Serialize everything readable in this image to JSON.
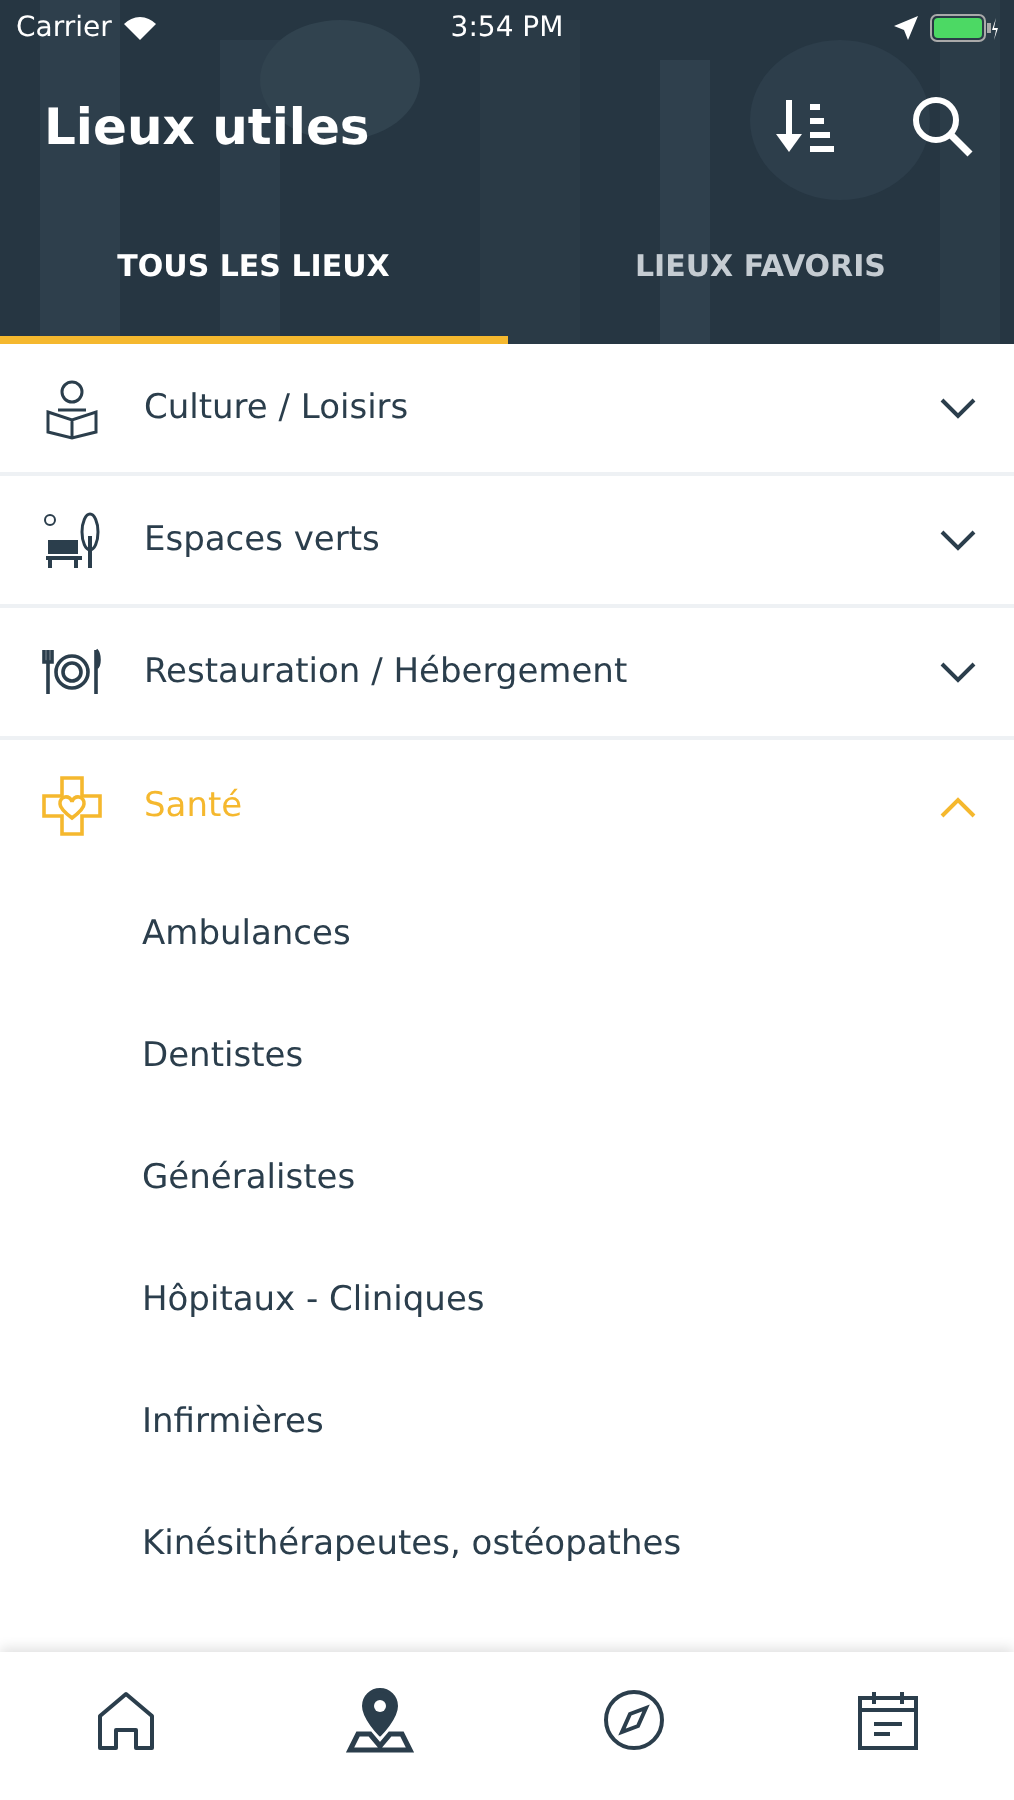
{
  "status_bar": {
    "carrier": "Carrier",
    "time": "3:54 PM"
  },
  "header": {
    "title": "Lieux utiles"
  },
  "tabs": [
    {
      "label": "TOUS LES LIEUX",
      "selected": true
    },
    {
      "label": "LIEUX FAVORIS",
      "selected": false
    }
  ],
  "categories": [
    {
      "kind": "culture",
      "label": "Culture / Loisirs",
      "expanded": false
    },
    {
      "kind": "park",
      "label": "Espaces verts",
      "expanded": false
    },
    {
      "kind": "food",
      "label": "Restauration / Hébergement",
      "expanded": false
    },
    {
      "kind": "health",
      "label": "Santé",
      "expanded": true,
      "children": [
        "Ambulances",
        "Dentistes",
        "Généralistes",
        "Hôpitaux - Cliniques",
        "Infirmières",
        "Kinésithérapeutes, ostéopathes"
      ]
    }
  ],
  "tab_bar": [
    {
      "kind": "home",
      "selected": false
    },
    {
      "kind": "map",
      "selected": true
    },
    {
      "kind": "compass",
      "selected": false
    },
    {
      "kind": "calendar",
      "selected": false
    }
  ]
}
